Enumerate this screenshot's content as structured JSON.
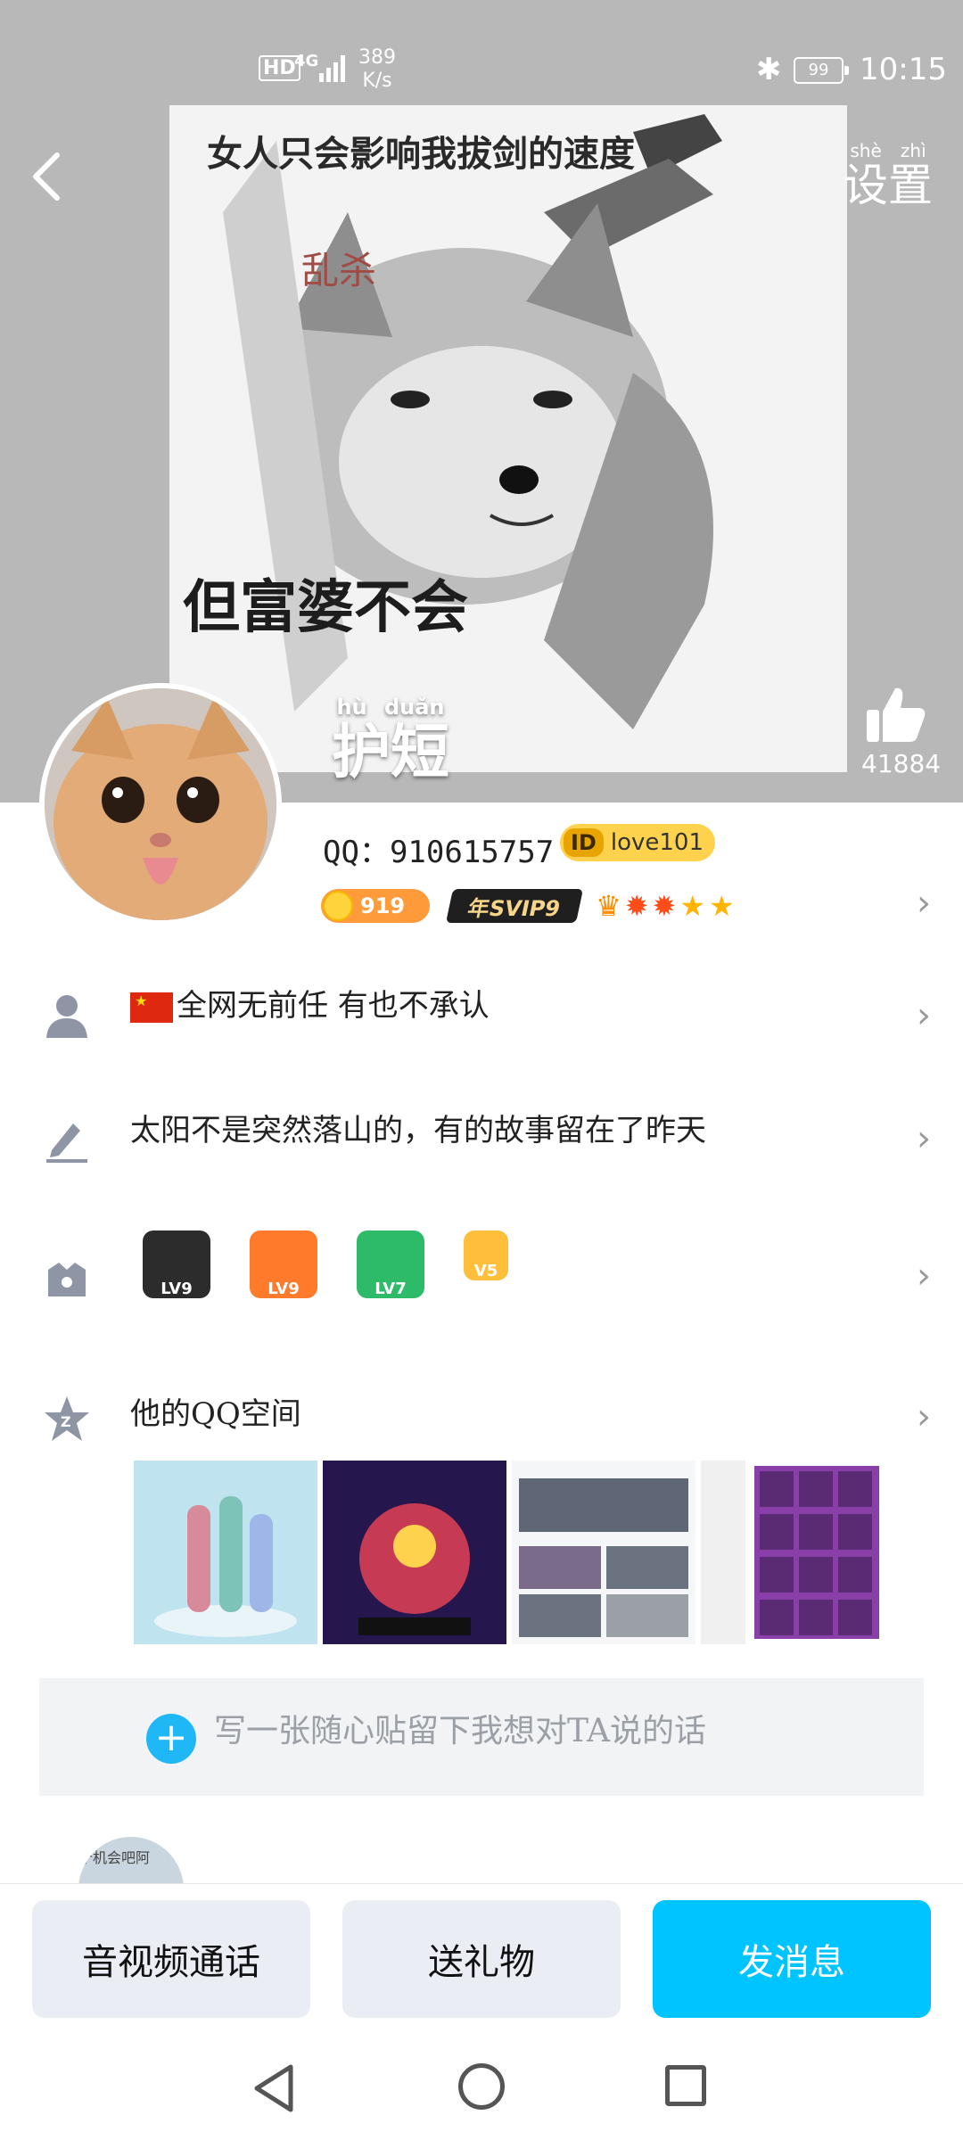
{
  "status_bar": {
    "hd": "HD",
    "network": "4G",
    "speed_value": "389",
    "speed_unit": "K/s",
    "battery": "99",
    "time": "10:15"
  },
  "header": {
    "settings_label": "设置",
    "settings_pinyin": [
      "shè",
      "zhì"
    ]
  },
  "cover": {
    "caption_top": "女人只会影响我拔剑的速度",
    "caption_red": "乱杀",
    "caption_bottom": "但富婆不会"
  },
  "profile": {
    "nickname": "护短",
    "nickname_pinyin": [
      "hù",
      "duǎn"
    ],
    "likes": "41884",
    "qq_label": "QQ：",
    "qq_number": "910615757",
    "id_tag": "love101",
    "coin_level": "919",
    "svip": "年SVIP9"
  },
  "rows": {
    "signature_tag": "全网无前任  有也不承认",
    "status_text": "太阳不是突然落山的，有的故事留在了昨天",
    "games_label": "LV9",
    "game_badges": [
      "LV9",
      "LV9",
      "LV7",
      "V5"
    ],
    "qzone_label": "他的QQ空间"
  },
  "note": {
    "placeholder": "写一张随心贴留下我想对TA说的话"
  },
  "partial_avatar_text": "个机会吧阿",
  "actions": {
    "call": "音视频通话",
    "gift": "送礼物",
    "message": "发消息"
  },
  "colors": {
    "accent": "#00c4ff",
    "button_bg": "#ebedf5",
    "cover_bg": "#b8b8b8"
  },
  "icons": [
    "back-icon",
    "like-icon",
    "person-icon",
    "edit-icon",
    "shield-icon",
    "qzone-icon",
    "plus-icon",
    "nav-back-icon",
    "nav-home-icon",
    "nav-recent-icon"
  ]
}
